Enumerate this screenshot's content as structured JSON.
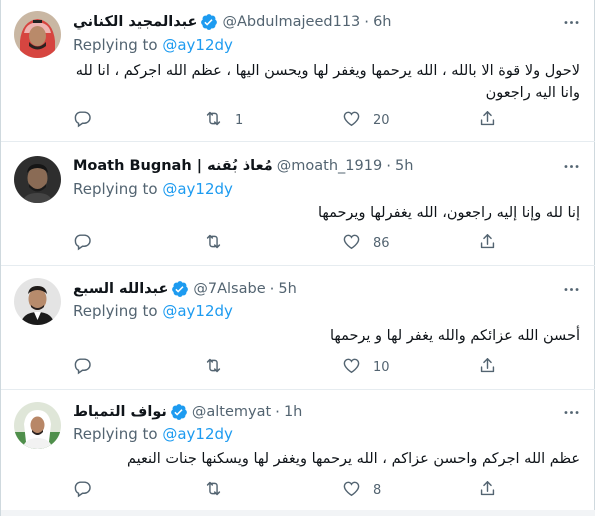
{
  "tweets": [
    {
      "name": "عبدالمجيد الكناني",
      "handle": "@Abdulmajeed113",
      "time": "6h",
      "replying_prefix": "Replying to ",
      "replying_to": "@ay12dy",
      "text": "لاحول ولا قوة الا بالله ، الله يرحمها ويغفر لها ويحسن اليها ، عظم الله اجركم ، انا لله وانا اليه راجعون",
      "replies": "",
      "retweets": "1",
      "likes": "20",
      "verified": true
    },
    {
      "name": "Moath Bugnah | مُعاذ بُقنه",
      "handle": "@moath_1919",
      "time": "5h",
      "replying_prefix": "Replying to ",
      "replying_to": "@ay12dy",
      "text": "إنا لله وإنا إليه راجعون، الله يغفرلها ويرحمها",
      "replies": "",
      "retweets": "",
      "likes": "86",
      "verified": false
    },
    {
      "name": "عبدالله السبع",
      "handle": "@7Alsabe",
      "time": "5h",
      "replying_prefix": "Replying to ",
      "replying_to": "@ay12dy",
      "text": "أحسن الله عزائكم والله يغفر لها و يرحمها",
      "replies": "",
      "retweets": "",
      "likes": "10",
      "verified": true
    },
    {
      "name": "نواف التمياط",
      "handle": "@altemyat",
      "time": "1h",
      "replying_prefix": "Replying to ",
      "replying_to": "@ay12dy",
      "text": "عظم الله اجركم واحسن عزاكم ، الله يرحمها ويغفر لها ويسكنها جنات النعيم",
      "replies": "",
      "retweets": "",
      "likes": "8",
      "verified": true
    }
  ],
  "separator": "·",
  "colors": {
    "accent": "#1d9bf0",
    "muted": "#536471",
    "text": "#0f1419",
    "divider": "#e6ecf0"
  },
  "icons": [
    "reply-icon",
    "retweet-icon",
    "like-icon",
    "share-icon",
    "more-icon",
    "verified-badge-icon"
  ]
}
